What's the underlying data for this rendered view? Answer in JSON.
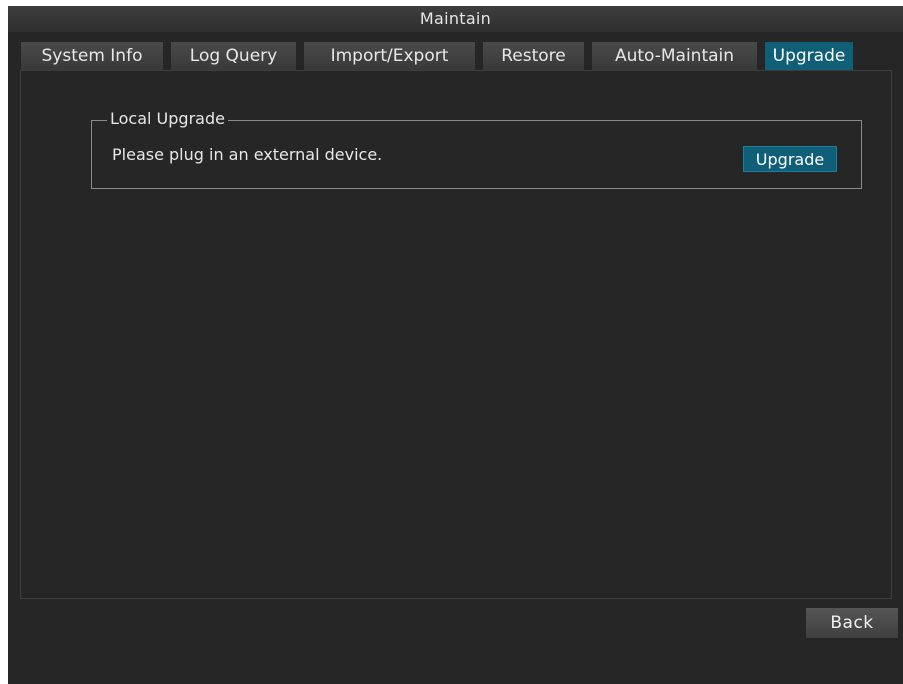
{
  "window": {
    "title": "Maintain"
  },
  "tabs": [
    {
      "label": "System Info",
      "active": false
    },
    {
      "label": "Log Query",
      "active": false
    },
    {
      "label": "Import/Export",
      "active": false
    },
    {
      "label": "Restore",
      "active": false
    },
    {
      "label": "Auto-Maintain",
      "active": false
    },
    {
      "label": "Upgrade",
      "active": true
    }
  ],
  "local_upgrade": {
    "legend": "Local Upgrade",
    "message": "Please plug in an external device.",
    "button_label": "Upgrade"
  },
  "footer": {
    "back_label": "Back"
  },
  "colors": {
    "background": "#262626",
    "accent": "#0f5f78",
    "text": "#e8e8e8"
  }
}
